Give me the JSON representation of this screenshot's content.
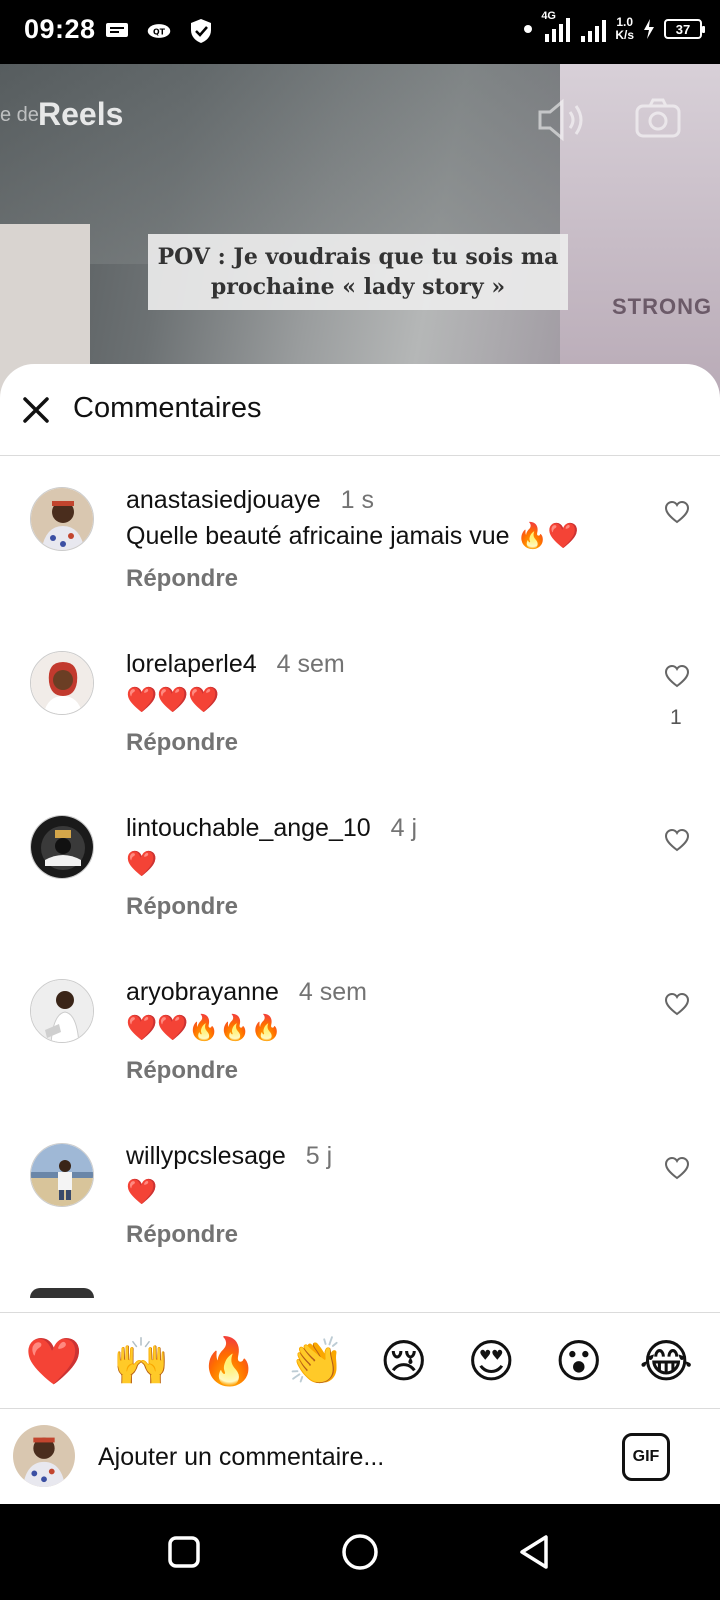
{
  "status_bar": {
    "time": "09:28",
    "network_speed_value": "1.0",
    "network_speed_unit": "K/s",
    "network_type": "4G",
    "battery": "37"
  },
  "video": {
    "reels_label": "Reels",
    "reels_prefix": "e de",
    "caption_line1": "POV : Je voudrais que tu sois ma",
    "caption_line2": "prochaine « lady story »",
    "brand_text": "STRONG"
  },
  "sheet": {
    "title": "Commentaires"
  },
  "comments": [
    {
      "username": "anastasiedjouaye",
      "time": "1 s",
      "text": "Quelle beauté africaine jamais vue 🔥❤️",
      "reply": "Répondre",
      "likes": ""
    },
    {
      "username": "lorelaperle4",
      "time": "4 sem",
      "text": "❤️❤️❤️",
      "reply": "Répondre",
      "likes": "1"
    },
    {
      "username": "lintouchable_ange_10",
      "time": "4 j",
      "text": "❤️",
      "reply": "Répondre",
      "likes": ""
    },
    {
      "username": "aryobrayanne",
      "time": "4 sem",
      "text": "❤️❤️🔥🔥🔥",
      "reply": "Répondre",
      "likes": ""
    },
    {
      "username": "willypcslesage",
      "time": "5 j",
      "text": "❤️",
      "reply": "Répondre",
      "likes": ""
    }
  ],
  "emoji_bar": [
    "❤️",
    "🙌",
    "🔥",
    "👏",
    "😢",
    "😍",
    "😮",
    "😂"
  ],
  "input": {
    "placeholder": "Ajouter un commentaire...",
    "gif_label": "GIF"
  },
  "colors": {
    "sheet_bg": "#ffffff",
    "muted_text": "#737373",
    "divider": "#dbdbdb",
    "nav_bg": "#000000"
  }
}
